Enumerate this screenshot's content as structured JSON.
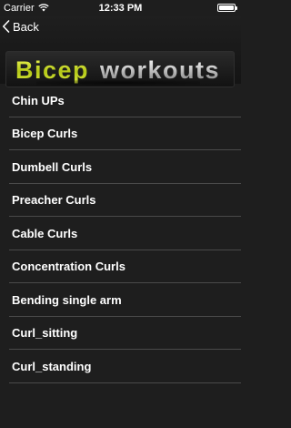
{
  "status_bar": {
    "carrier": "Carrier",
    "time": "12:33 PM"
  },
  "nav": {
    "back_label": "Back"
  },
  "banner": {
    "word1": "Bicep",
    "word2": "workouts"
  },
  "exercises": [
    "Chin UPs",
    "Bicep Curls",
    "Dumbell Curls",
    "Preacher Curls",
    "Cable Curls",
    "Concentration Curls",
    "Bending single arm",
    "Curl_sitting",
    "Curl_standing"
  ],
  "colors": {
    "background": "#1e1e1e",
    "banner_accent": "#d2e02a",
    "separator": "#4a4a4a"
  }
}
